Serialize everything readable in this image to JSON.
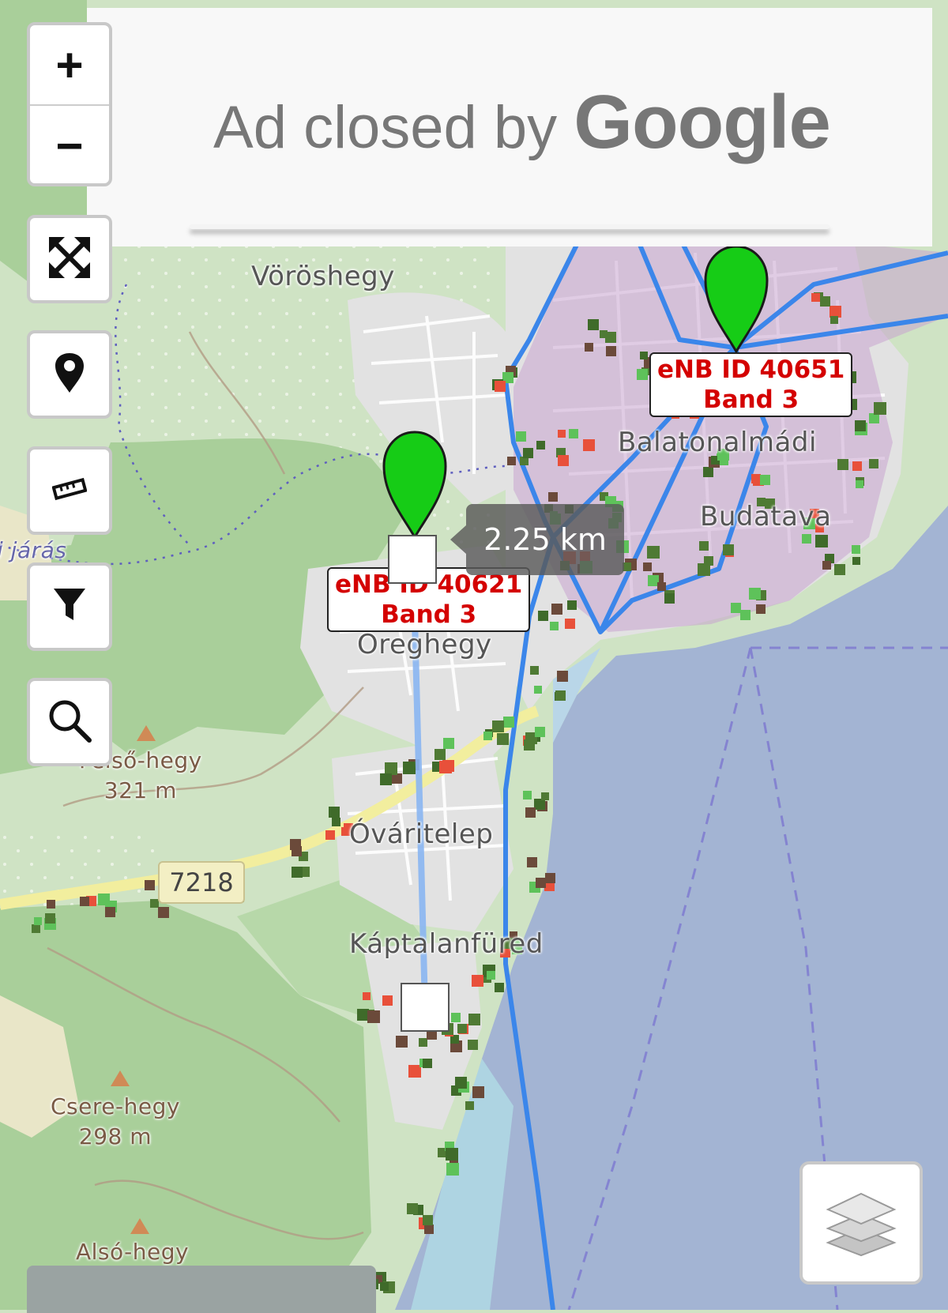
{
  "ad": {
    "prefix": "Ad closed by",
    "brand": "Google"
  },
  "controls": {
    "zoom_in": "+",
    "zoom_out": "−"
  },
  "places": {
    "voroshegy": "Vöröshegy",
    "balatonalmadi": "Balatonalmádi",
    "budatava": "Budatava",
    "oreghegy": "Öreghegy",
    "varitelep": "Óváritelep",
    "kaptalanfured": "Káptalanfüred",
    "jaras": "i járás",
    "felso_hegy": "Felső-hegy",
    "felso_hegy_elev": "321 m",
    "csere_hegy": "Csere-hegy",
    "csere_hegy_elev": "298 m",
    "also_hegy": "Alsó-hegy"
  },
  "road_number": "7218",
  "markers": [
    {
      "line1": "eNB ID 40651",
      "line2": "Band 3"
    },
    {
      "line1": "eNB ID 40621",
      "line2": "Band 3"
    }
  ],
  "distance": "2.25 km",
  "colors": {
    "marker_green": "#16cc16",
    "sector_blue": "#3b86ea",
    "label_red": "#d40000",
    "lake": "#a3b4d3",
    "forest": "#a9cf9a",
    "urban": "#e0e0e0",
    "coverage_fill": "#c9a4cf"
  },
  "icons": [
    "zoom-in-icon",
    "zoom-out-icon",
    "fullscreen-icon",
    "location-pin-icon",
    "ruler-icon",
    "filter-icon",
    "search-icon",
    "layers-icon"
  ]
}
